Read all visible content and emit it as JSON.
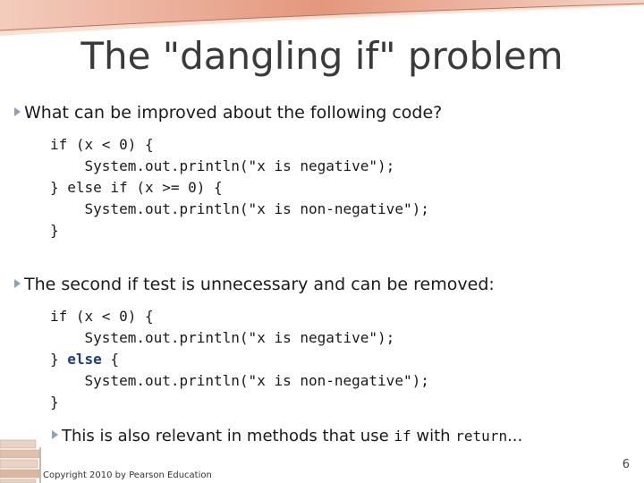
{
  "slide": {
    "title": "The \"dangling if\" problem",
    "bullet1": "What can be improved about the following code?",
    "code1": [
      "if (x < 0) {",
      "    System.out.println(\"x is negative\");",
      "} else if (x >= 0) {",
      "    System.out.println(\"x is non-negative\");",
      "}"
    ],
    "bullet2": "The second if test is unnecessary and can be removed:",
    "code2": {
      "line1": "if (x < 0) {",
      "line2": "    System.out.println(\"x is negative\");",
      "line3_prefix": "} ",
      "line3_keyword": "else",
      "line3_suffix": " {",
      "line4": "    System.out.println(\"x is non-negative\");",
      "line5": "}"
    },
    "sub_bullet": {
      "text1": "This is also relevant in methods that use ",
      "code1": "if",
      "text2": " with ",
      "code2": "return",
      "text3": "..."
    },
    "copyright": "Copyright 2010 by Pearson Education",
    "page_number": "6"
  },
  "colors": {
    "title": "#3a3a3a",
    "bullet_marker": "#8aa3b8",
    "keyword_highlight": "#1b3a8a",
    "top_decoration": "#d9826b"
  }
}
